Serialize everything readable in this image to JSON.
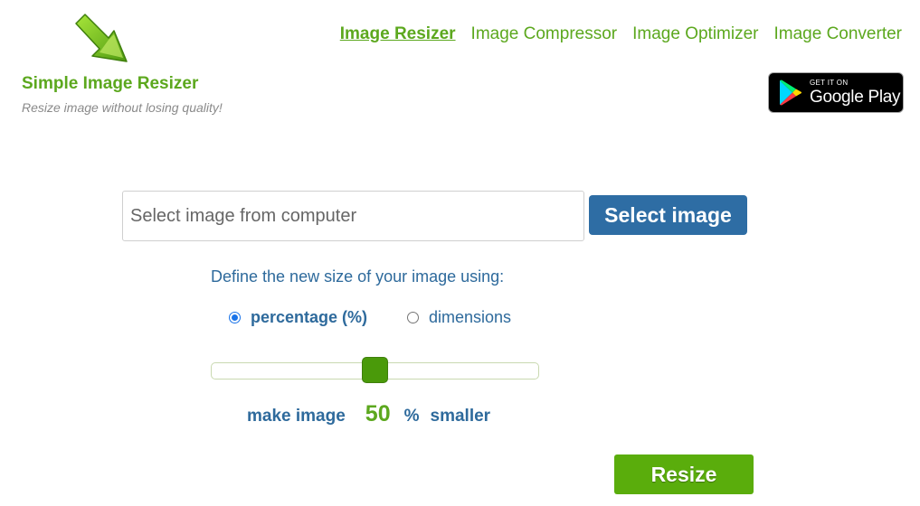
{
  "brand": {
    "title": "Simple Image Resizer",
    "tagline": "Resize image without losing quality!",
    "logo_icon": "green-arrow-down-right-icon"
  },
  "nav": {
    "items": [
      {
        "label": "Image Resizer",
        "active": true
      },
      {
        "label": "Image Compressor",
        "active": false
      },
      {
        "label": "Image Optimizer",
        "active": false
      },
      {
        "label": "Image Converter",
        "active": false
      }
    ]
  },
  "store_badge": {
    "small_text": "GET IT ON",
    "big_text": "Google Play"
  },
  "upload": {
    "placeholder": "Select image from computer",
    "button_label": "Select image"
  },
  "options": {
    "define_label": "Define the new size of your image using:",
    "modes": [
      {
        "label": "percentage (%)",
        "checked": true
      },
      {
        "label": "dimensions",
        "checked": false
      }
    ]
  },
  "slider": {
    "value_percent": 50
  },
  "result": {
    "prefix": "make image",
    "value": "50",
    "unit": "%",
    "suffix": "smaller"
  },
  "resize_button": {
    "label": "Resize"
  },
  "colors": {
    "brand_green": "#5ca81e",
    "primary_blue": "#2e6da4",
    "resize_green": "#5aad0c"
  }
}
